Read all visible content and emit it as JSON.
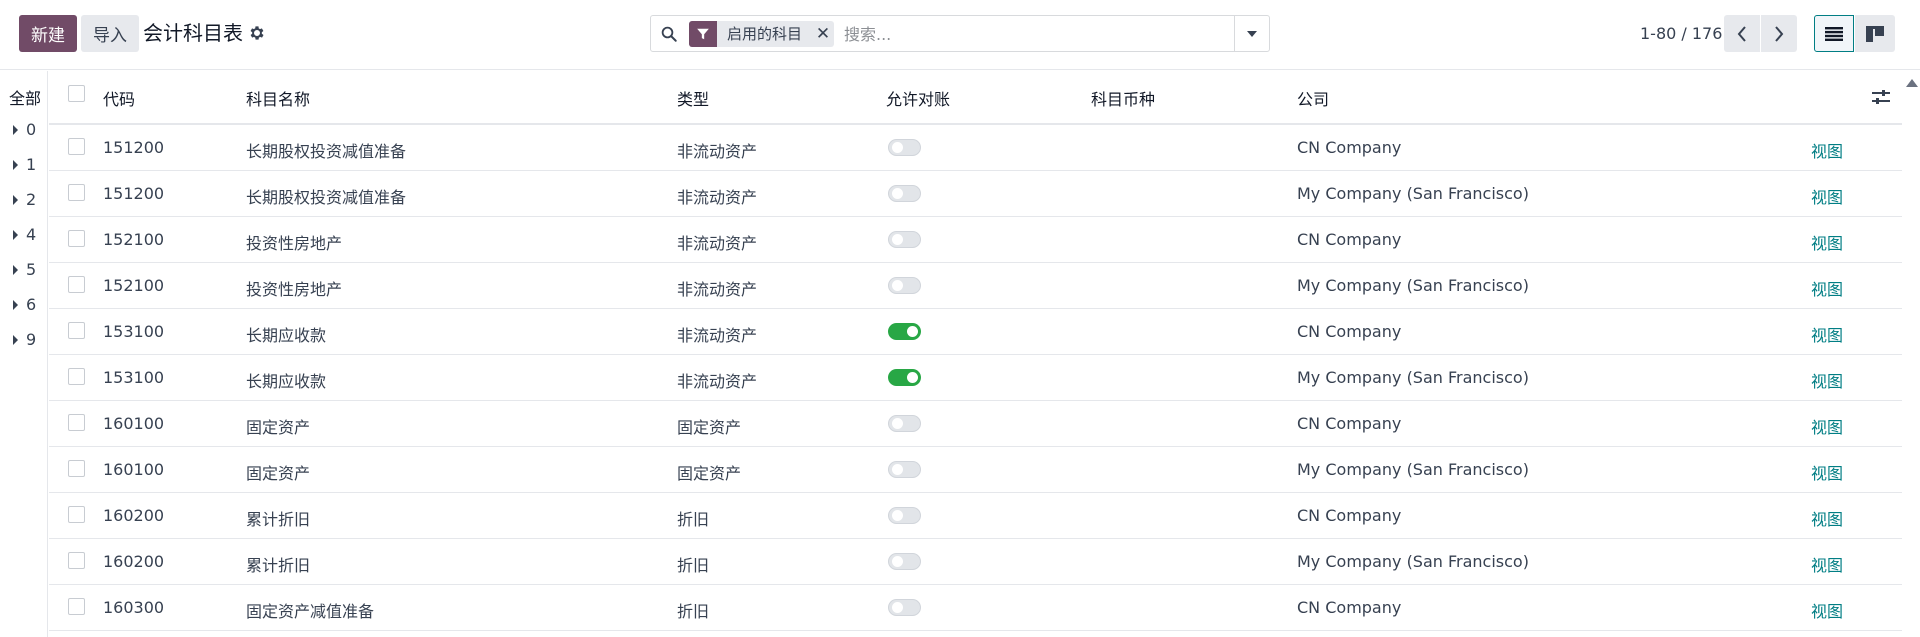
{
  "control_panel": {
    "new_label": "新建",
    "import_label": "导入",
    "title": "会计科目表"
  },
  "search": {
    "facet_label": "启用的科目",
    "placeholder": "搜索..."
  },
  "pager": {
    "value": "1-80 / 176"
  },
  "side_panel": {
    "all_label": "全部",
    "groups": [
      "0",
      "1",
      "2",
      "4",
      "5",
      "6",
      "9"
    ]
  },
  "table": {
    "columns": {
      "code": "代码",
      "name": "科目名称",
      "type": "类型",
      "reconcile": "允许对账",
      "currency": "科目币种",
      "company": "公司"
    },
    "rows": [
      {
        "code": "151200",
        "name": "长期股权投资减值准备",
        "type": "非流动资产",
        "reconcile": false,
        "company": "CN Company",
        "action": "视图"
      },
      {
        "code": "151200",
        "name": "长期股权投资减值准备",
        "type": "非流动资产",
        "reconcile": false,
        "company": "My Company (San Francisco)",
        "action": "视图"
      },
      {
        "code": "152100",
        "name": "投资性房地产",
        "type": "非流动资产",
        "reconcile": false,
        "company": "CN Company",
        "action": "视图"
      },
      {
        "code": "152100",
        "name": "投资性房地产",
        "type": "非流动资产",
        "reconcile": false,
        "company": "My Company (San Francisco)",
        "action": "视图"
      },
      {
        "code": "153100",
        "name": "长期应收款",
        "type": "非流动资产",
        "reconcile": true,
        "company": "CN Company",
        "action": "视图"
      },
      {
        "code": "153100",
        "name": "长期应收款",
        "type": "非流动资产",
        "reconcile": true,
        "company": "My Company (San Francisco)",
        "action": "视图"
      },
      {
        "code": "160100",
        "name": "固定资产",
        "type": "固定资产",
        "reconcile": false,
        "company": "CN Company",
        "action": "视图"
      },
      {
        "code": "160100",
        "name": "固定资产",
        "type": "固定资产",
        "reconcile": false,
        "company": "My Company (San Francisco)",
        "action": "视图"
      },
      {
        "code": "160200",
        "name": "累计折旧",
        "type": "折旧",
        "reconcile": false,
        "company": "CN Company",
        "action": "视图"
      },
      {
        "code": "160200",
        "name": "累计折旧",
        "type": "折旧",
        "reconcile": false,
        "company": "My Company (San Francisco)",
        "action": "视图"
      },
      {
        "code": "160300",
        "name": "固定资产减值准备",
        "type": "折旧",
        "reconcile": false,
        "company": "CN Company",
        "action": "视图"
      }
    ]
  },
  "colors": {
    "primary": "#714b67",
    "link": "#017e84",
    "toggle_on": "#28a745"
  }
}
